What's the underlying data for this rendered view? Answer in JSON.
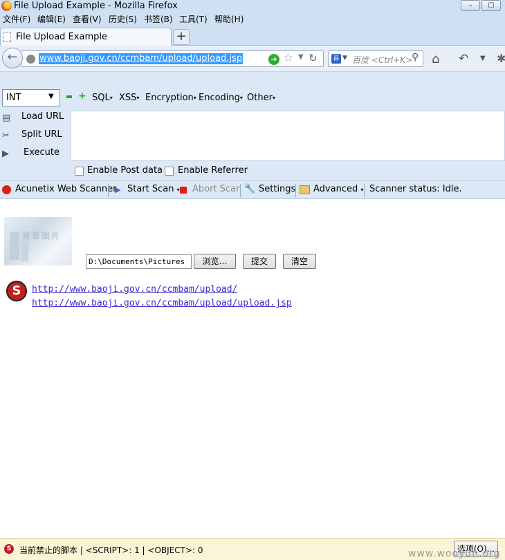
{
  "window": {
    "title": "File Upload Example - Mozilla Firefox",
    "minimize": "–",
    "maximize": "▢"
  },
  "menubar": [
    "文件(F)",
    "编辑(E)",
    "查看(V)",
    "历史(S)",
    "书签(B)",
    "工具(T)",
    "帮助(H)"
  ],
  "tab": {
    "label": "File Upload Example",
    "new_tab": "+"
  },
  "navbar": {
    "url": "www.baoji.gov.cn/ccmbam/upload/upload.jsp",
    "search_placeholder": "百度 <Ctrl+K>"
  },
  "hackbar": {
    "select_value": "INT",
    "menus": [
      "SQL",
      "XSS",
      "Encryption",
      "Encoding",
      "Other"
    ],
    "side": [
      "Load URL",
      "Split URL",
      "Execute"
    ],
    "checkboxes": [
      "Enable Post data",
      "Enable Referrer"
    ]
  },
  "acunetix": {
    "brand": "Acunetix Web Scanner",
    "start": "Start Scan",
    "abort": "Abort Scan",
    "settings": "Settings",
    "advanced": "Advanced",
    "status": "Scanner status: Idle."
  },
  "content": {
    "thumb_title": "背景图片",
    "file_path": "D:\\Documents\\Pictures",
    "browse": "浏览…",
    "submit": "提交",
    "clear": "清空",
    "links": [
      "http://www.baoji.gov.cn/ccmbam/upload/",
      "http://www.baoji.gov.cn/ccmbam/upload/upload.jsp"
    ]
  },
  "statusbar": {
    "message": "当前禁止的脚本 | <SCRIPT>: 1 | <OBJECT>: 0",
    "options": "选项(O)...",
    "watermark": "www.wooyun.org"
  },
  "colors": {
    "chrome": "#cfe0f3",
    "hackbar": "#dce8f5",
    "url_selection": "#3399ff",
    "link": "#3a2bd0"
  }
}
